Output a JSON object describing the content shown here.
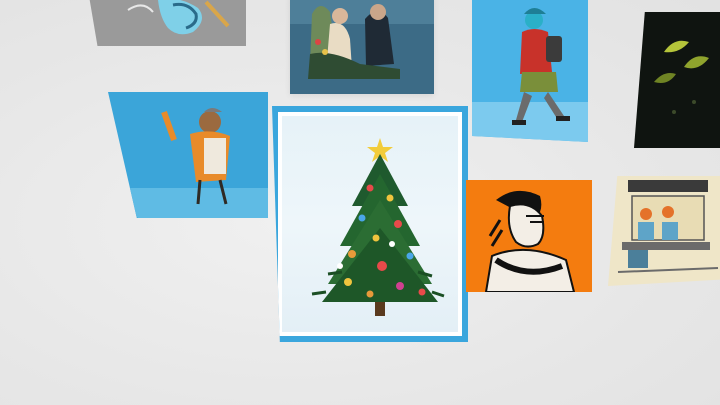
{
  "gallery": {
    "artworks": [
      {
        "id": "tl",
        "subject": "blue-bird-drawing"
      },
      {
        "id": "tm",
        "subject": "two-figures-painting"
      },
      {
        "id": "tr",
        "subject": "walking-backpacker"
      },
      {
        "id": "far-right",
        "subject": "dark-leaf-pattern"
      },
      {
        "id": "ml",
        "subject": "waving-man-orange"
      },
      {
        "id": "center",
        "subject": "christmas-tree",
        "selected": true
      },
      {
        "id": "mr",
        "subject": "profile-portrait-orange"
      },
      {
        "id": "br",
        "subject": "cafe-counter-scene"
      }
    ],
    "colors": {
      "background": "#ebebeb",
      "selection_border": "#3aa6dd",
      "sky_blue": "#3aa6dd",
      "orange": "#f47c0f"
    }
  }
}
